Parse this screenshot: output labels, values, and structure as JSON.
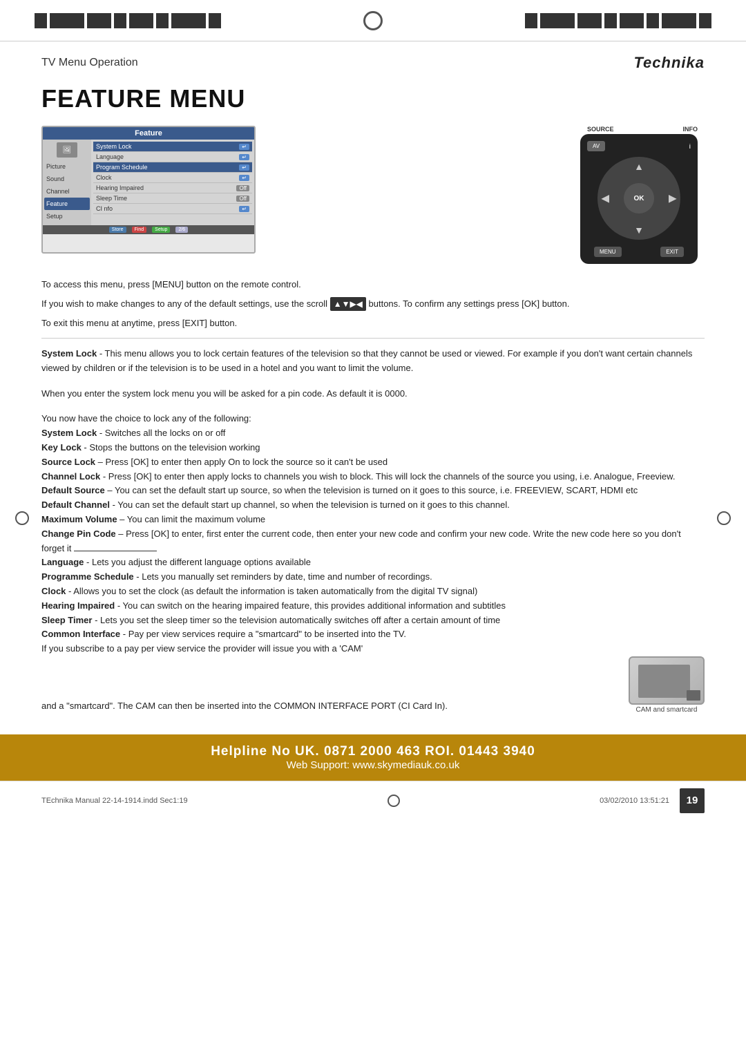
{
  "page": {
    "number": "19",
    "file_info": "TEchnika Manual 22-14-1914.indd  Sec1:19",
    "date_info": "03/02/2010   13:51:21"
  },
  "header": {
    "section_label": "TV Menu Operation",
    "logo": "Technika"
  },
  "title": "FEATURE MENU",
  "tv_menu": {
    "title": "Feature",
    "sidebar_items": [
      "Picture",
      "Sound",
      "Channel",
      "Feature",
      "Setup"
    ],
    "menu_rows": [
      {
        "label": "System Lock",
        "value": "↵"
      },
      {
        "label": "Language",
        "value": "↵"
      },
      {
        "label": "Program Schedule",
        "value": "↵"
      },
      {
        "label": "Clock",
        "value": "↵"
      },
      {
        "label": "Hearing Impaired",
        "value": "Off"
      },
      {
        "label": "Sleep Time",
        "value": "Off"
      },
      {
        "label": "CI nfo",
        "value": "↵"
      }
    ],
    "bottom_buttons": [
      "Store",
      "Find",
      "Setup",
      "2/6"
    ]
  },
  "remote": {
    "source_label": "SOURCE",
    "info_label": "INFO",
    "av_label": "AV",
    "ok_label": "OK",
    "menu_label": "MENU",
    "exit_label": "EXIT"
  },
  "paragraphs": [
    {
      "id": "p1",
      "text": "To access this menu, press [MENU] button on the remote control."
    },
    {
      "id": "p2",
      "text": "If you wish to make changes to any of the default settings, use the scroll ▲▼▶◀ buttons. To confirm any settings press [OK] button."
    },
    {
      "id": "p3",
      "text": "To exit this menu at anytime, press [EXIT] button."
    }
  ],
  "feature_items": [
    {
      "id": "system-lock",
      "label": "System Lock",
      "desc": "This menu allows you to lock certain features of the television so that they cannot be used or viewed. For example if you don't want certain channels viewed by children or if the television is to be used in a hotel and you want to limit the volume."
    },
    {
      "id": "pin-code",
      "label": "",
      "desc": "When you enter the system lock menu you will be asked for a pin code. As default it is 0000."
    },
    {
      "id": "choice-intro",
      "label": "",
      "desc": "You now have the choice to lock any of the following:"
    },
    {
      "id": "system-lock-sub",
      "label": "System Lock",
      "desc": "Switches all the locks on or off"
    },
    {
      "id": "key-lock",
      "label": "Key Lock",
      "desc": "Stops the buttons on the television working"
    },
    {
      "id": "source-lock",
      "label": "Source Lock",
      "desc": "Press [OK] to enter then apply On to lock the source so it can't be used"
    },
    {
      "id": "channel-lock",
      "label": "Channel Lock",
      "desc": "Press [OK] to enter then apply locks to channels you wish to block. This will lock the channels of the source you using, i.e. Analogue, Freeview."
    },
    {
      "id": "default-source",
      "label": "Default Source",
      "desc": "You can set the default start up source, so when the television is turned on it goes to this source, i.e. FREEVIEW, SCART, HDMI etc"
    },
    {
      "id": "default-channel",
      "label": "Default Channel",
      "desc": "You can set the default start up channel, so when the television is turned on it goes to this channel."
    },
    {
      "id": "max-volume",
      "label": "Maximum Volume",
      "desc": "You can limit the maximum volume"
    },
    {
      "id": "change-pin",
      "label": "Change Pin Code",
      "desc": "Press [OK] to enter, first enter the current code, then enter your new code and confirm your new code. Write the new code here so you don't forget it _______________"
    },
    {
      "id": "language",
      "label": "Language",
      "desc": "Lets you adjust the different language options available"
    },
    {
      "id": "programme-schedule",
      "label": "Programme Schedule",
      "desc": "Lets you manually set reminders by date, time and number of recordings."
    },
    {
      "id": "clock",
      "label": "Clock",
      "desc": "Allows you to set the clock (as default the information is taken automatically from the digital TV signal)"
    },
    {
      "id": "hearing-impaired",
      "label": "Hearing Impaired",
      "desc": "You can switch on the hearing impaired feature, this provides additional information and subtitles"
    },
    {
      "id": "sleep-timer",
      "label": "Sleep Timer",
      "desc": "Lets you set the sleep timer so the television automatically switches off after a certain amount of time"
    },
    {
      "id": "common-interface",
      "label": "Common Interface",
      "desc": "Pay per view services require a \"smartcard\" to be inserted into the TV."
    },
    {
      "id": "ci-sub1",
      "label": "",
      "desc": "If you subscribe to a pay per view service the provider will issue you with a 'CAM'"
    },
    {
      "id": "ci-sub2",
      "label": "",
      "desc": "and a \"smartcard\". The CAM can then be inserted into the COMMON INTERFACE PORT (CI Card In)."
    }
  ],
  "cam_label": "CAM and smartcard",
  "footer": {
    "helpline": "Helpline No UK. 0871 2000 463  ROI. 01443 3940",
    "websupport": "Web Support: www.skymediauk.co.uk"
  }
}
